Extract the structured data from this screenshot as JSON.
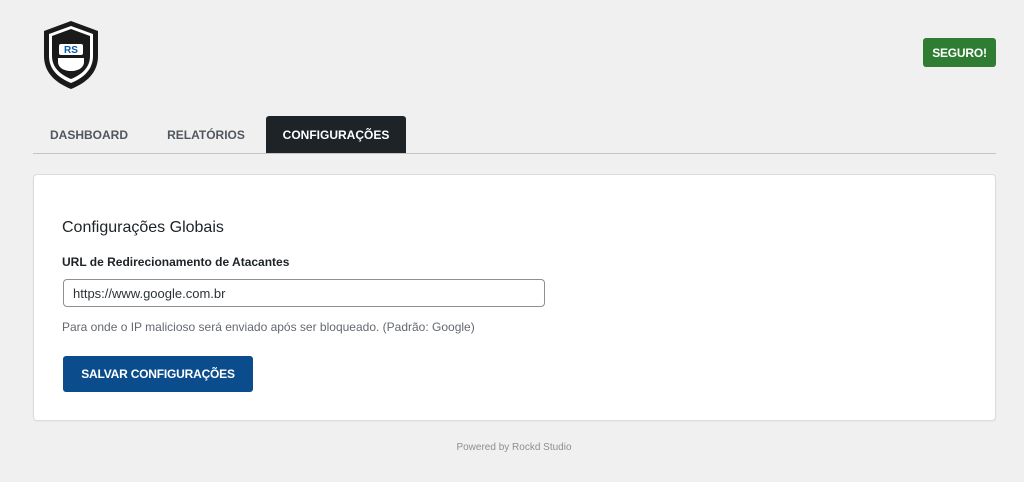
{
  "header": {
    "logo_text": "RS",
    "status_badge": "SEGURO!"
  },
  "tabs": [
    {
      "label": "DASHBOARD",
      "active": false
    },
    {
      "label": "RELATÓRIOS",
      "active": false
    },
    {
      "label": "CONFIGURAÇÕES",
      "active": true
    }
  ],
  "settings": {
    "section_title": "Configurações Globais",
    "field_label": "URL de Redirecionamento de Atacantes",
    "url_value": "https://www.google.com.br",
    "help_text": "Para onde o IP malicioso será enviado após ser bloqueado. (Padrão: Google)",
    "save_label": "SALVAR CONFIGURAÇÕES"
  },
  "footer": {
    "text": "Powered by Rockd Studio"
  },
  "colors": {
    "background": "#f0f0f0",
    "badge_green": "#2e7d32",
    "active_tab": "#1d2327",
    "primary_button": "#0b4d8c"
  },
  "icons": {
    "logo": "shield-helmet-logo-icon"
  }
}
